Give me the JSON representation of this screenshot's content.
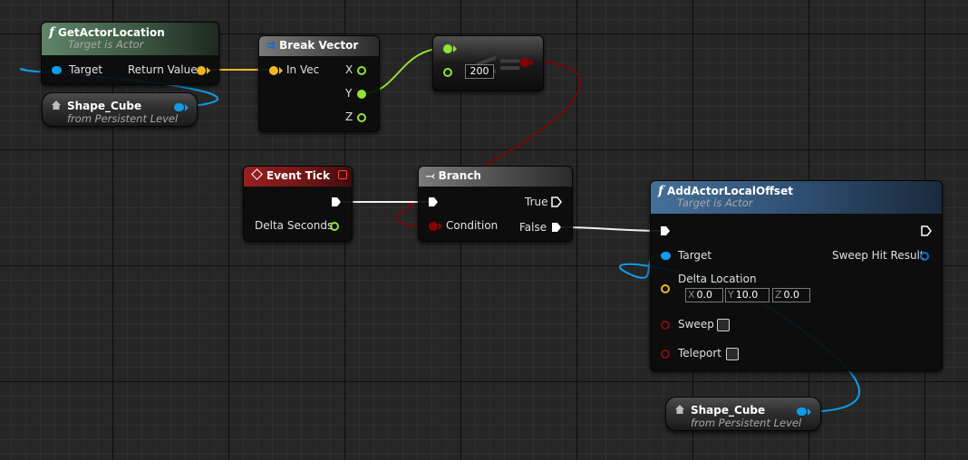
{
  "nodes": {
    "get_actor_location": {
      "title": "GetActorLocation",
      "subtitle": "Target is Actor",
      "pin_target": "Target",
      "pin_return": "Return Value",
      "icon": "function-icon"
    },
    "shape_cube_top": {
      "title": "Shape_Cube",
      "subtitle": "from Persistent Level",
      "icon": "house-icon"
    },
    "break_vector": {
      "title": "Break Vector",
      "pin_in": "In Vec",
      "pin_x": "X",
      "pin_y": "Y",
      "pin_z": "Z",
      "icon": "break-struct-icon"
    },
    "compare": {
      "operator": "<=",
      "value": "200"
    },
    "event_tick": {
      "title": "Event Tick",
      "pin_delta": "Delta Seconds",
      "icon": "event-diamond-icon"
    },
    "branch": {
      "title": "Branch",
      "pin_condition": "Condition",
      "pin_true": "True",
      "pin_false": "False",
      "icon": "branch-icon"
    },
    "add_actor_local_offset": {
      "title": "AddActorLocalOffset",
      "subtitle": "Target is Actor",
      "pin_target": "Target",
      "pin_sweep_result": "Sweep Hit Result",
      "pin_delta": "Delta Location",
      "delta": {
        "x_label": "X",
        "x": "0.0",
        "y_label": "Y",
        "y": "10.0",
        "z_label": "Z",
        "z": "0.0"
      },
      "pin_sweep": "Sweep",
      "pin_teleport": "Teleport",
      "icon": "function-icon"
    },
    "shape_cube_bottom": {
      "title": "Shape_Cube",
      "subtitle": "from Persistent Level",
      "icon": "house-icon"
    }
  },
  "colors": {
    "exec": "#ffffff",
    "object": "#0d9de8",
    "vector": "#f0b81c",
    "float": "#90e431",
    "bool": "#8a0000",
    "struct": "#0d6fd0"
  }
}
